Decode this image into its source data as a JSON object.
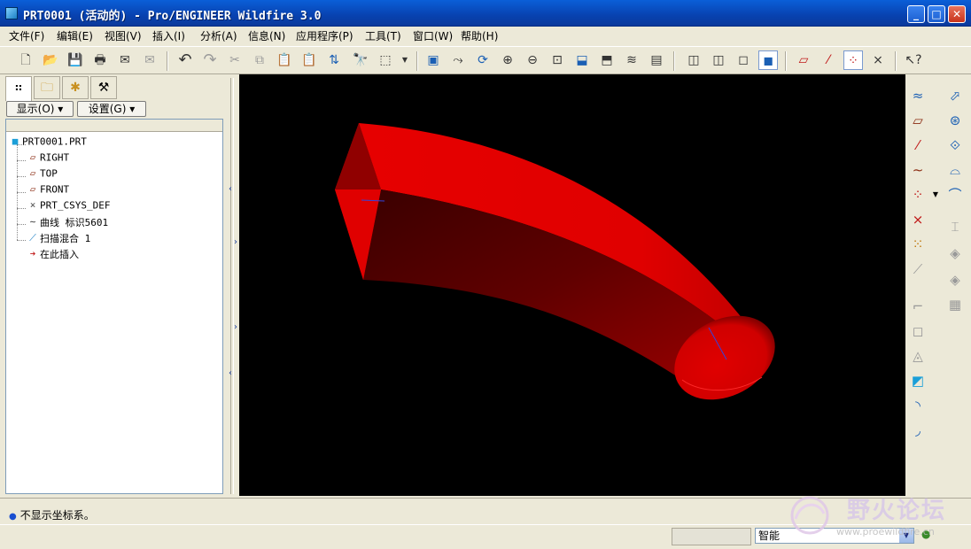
{
  "window": {
    "title": "PRT0001 (活动的) - Pro/ENGINEER Wildfire 3.0",
    "minimize": "_",
    "maximize": "□",
    "close": "✕"
  },
  "menu": {
    "items": [
      "文件(F)",
      "编辑(E)",
      "视图(V)",
      "插入(I)",
      "分析(A)",
      "信息(N)",
      "应用程序(P)",
      "工具(T)",
      "窗口(W)",
      "帮助(H)"
    ]
  },
  "toolbar": {
    "icons": [
      "new-icon",
      "open-icon",
      "save-icon",
      "print-icon",
      "send-mail-icon",
      "send-link-icon",
      "undo-icon",
      "redo-icon",
      "cut-icon",
      "copy-icon",
      "paste-icon",
      "paste-special-icon",
      "regenerate-icon",
      "find-icon",
      "select-box-icon",
      "repaint-icon",
      "spin-center-icon",
      "orient-icon",
      "zoom-in-icon",
      "zoom-out-icon",
      "refit-icon",
      "reorient-icon",
      "saved-views-icon",
      "layers-icon",
      "view-manager-icon",
      "wireframe-icon",
      "hidden-line-icon",
      "no-hidden-icon",
      "shading-icon",
      "datum-planes-icon",
      "datum-axes-icon",
      "datum-points-icon",
      "coord-sys-icon",
      "whats-this-icon"
    ]
  },
  "leftpanel": {
    "tabs": [
      "model-tree-tab",
      "folder-browser-tab",
      "favorites-tab",
      "connections-tab"
    ],
    "show_button": "显示(O)",
    "settings_button": "设置(G)",
    "tree": [
      {
        "label": "PRT0001.PRT",
        "icon": "part-icon"
      },
      {
        "label": "RIGHT",
        "icon": "datum-plane-icon"
      },
      {
        "label": "TOP",
        "icon": "datum-plane-icon"
      },
      {
        "label": "FRONT",
        "icon": "datum-plane-icon"
      },
      {
        "label": "PRT_CSYS_DEF",
        "icon": "csys-icon"
      },
      {
        "label": "曲线 标识5601",
        "icon": "curve-icon"
      },
      {
        "label": "扫描混合 1",
        "icon": "swept-blend-icon"
      },
      {
        "label": "在此插入",
        "icon": "insert-here-icon"
      }
    ]
  },
  "colors": {
    "solid": "#e00000",
    "solid_dark": "#5a0000",
    "background": "#000000",
    "accent": "#0a5fd8"
  },
  "message": {
    "text": "不显示坐标系。"
  },
  "status": {
    "filter_value": "智能"
  },
  "watermark": {
    "title": "野火论坛",
    "url": "www.proewildfire.cn"
  }
}
